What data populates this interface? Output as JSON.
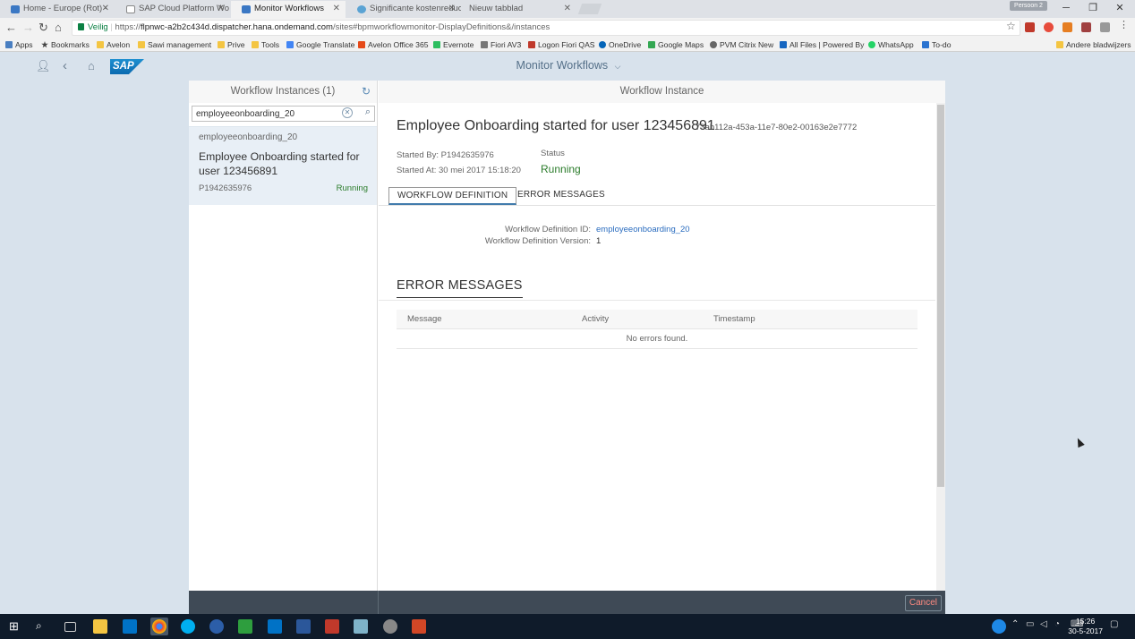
{
  "browser": {
    "tabs": [
      {
        "label": "Home - Europe (Rot) -",
        "icon_color": "#3b78c4"
      },
      {
        "label": "SAP Cloud Platform Wo",
        "icon_color": "#888888"
      },
      {
        "label": "Monitor Workflows",
        "icon_color": "#3b78c4"
      },
      {
        "label": "Significante kostenreduc",
        "icon_color": "#5aa3d4"
      },
      {
        "label": "Nieuw tabblad",
        "icon_color": "#ffffff"
      }
    ],
    "profile_label": "Persoon 2",
    "url_secure": "Veilig",
    "url_scheme": "https://",
    "url_host": "flpnwc-a2b2c434d.dispatcher.hana.ondemand.com",
    "url_path": "/sites#bpmworkflowmonitor-DisplayDefinitions&/instances",
    "bookmarks": [
      "Apps",
      "Bookmarks",
      "Avelon",
      "Sawi management",
      "Prive",
      "Tools",
      "Google Translate",
      "Avelon Office 365",
      "Evernote",
      "Fiori AV3",
      "Logon Fiori QAS",
      "OneDrive",
      "Google Maps",
      "PVM Citrix New",
      "All Files | Powered By",
      "WhatsApp",
      "To-do",
      "Andere bladwijzers"
    ]
  },
  "shell": {
    "title": "Monitor Workflows",
    "logo_text": "SAP"
  },
  "master": {
    "header": "Workflow Instances (1)",
    "search_value": "employeeonboarding_20",
    "item": {
      "subtitle": "employeeonboarding_20",
      "title": "Employee Onboarding started for user 123456891",
      "user": "P1942635976",
      "status": "Running"
    }
  },
  "detail": {
    "header": "Workflow Instance",
    "title": "Employee Onboarding started for user 123456891",
    "instance_id": "73ab112a-453a-11e7-80e2-00163e2e7772",
    "started_by": "Started By: P1942635976",
    "started_at": "Started At: 30 mei 2017 15:18:20",
    "status_label": "Status",
    "status_value": "Running",
    "tabs": [
      "WORKFLOW DEFINITION",
      "ERROR MESSAGES"
    ],
    "def_id_label": "Workflow Definition ID:",
    "def_id_value": "employeeonboarding_20",
    "def_version_label": "Workflow Definition Version:",
    "def_version_value": "1",
    "errors_title": "ERROR MESSAGES",
    "error_columns": [
      "Message",
      "Activity",
      "Timestamp"
    ],
    "no_errors": "No errors found."
  },
  "footer": {
    "cancel_label": "Cancel"
  },
  "taskbar": {
    "time": "15:26",
    "date": "30-5-2017"
  }
}
